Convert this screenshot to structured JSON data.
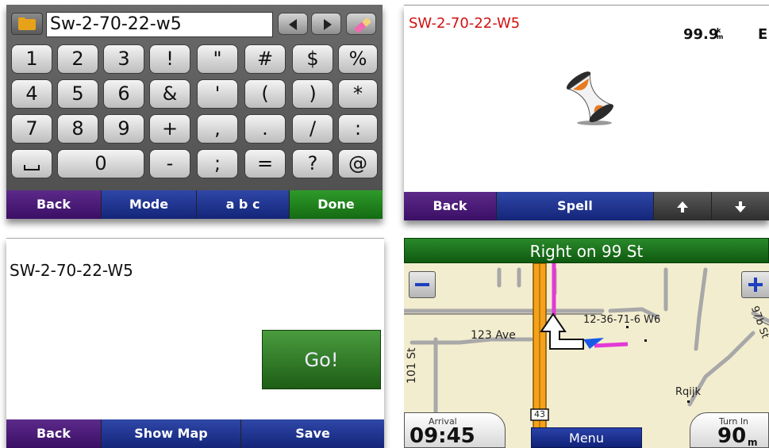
{
  "keyboard_screen": {
    "input_value": "Sw-2-70-22-w5",
    "keys": [
      [
        "1",
        "2",
        "3",
        "!",
        "\"",
        "#",
        "$",
        "%"
      ],
      [
        "4",
        "5",
        "6",
        "&",
        "'",
        "(",
        ")",
        "*"
      ],
      [
        "7",
        "8",
        "9",
        "+",
        ",",
        ".",
        "/",
        ":"
      ],
      [
        "",
        "0",
        "-",
        ";",
        "=",
        "?",
        "@"
      ]
    ],
    "buttons": {
      "back": "Back",
      "mode": "Mode",
      "abc": "a b c",
      "done": "Done"
    }
  },
  "search_screen": {
    "title": "SW-2-70-22-W5",
    "progress_text": "99.9",
    "progress_unit": "k\nm",
    "direction": "E",
    "buttons": {
      "back": "Back",
      "spell": "Spell"
    }
  },
  "address_screen": {
    "title": "SW-2-70-22-W5",
    "go_label": "Go!",
    "buttons": {
      "back": "Back",
      "show_map": "Show Map",
      "save": "Save"
    }
  },
  "map_screen": {
    "next_turn": "Right on 99 St",
    "labels": {
      "ave_123": "123 Ave",
      "st_101": "101 St",
      "destination": "12-36-71-6 W6",
      "poi": "Rqijk",
      "st_97b": "97b St",
      "highway": "43"
    },
    "arrival_label": "Arrival",
    "arrival_value": "09:45",
    "turn_label": "Turn In",
    "turn_value": "90",
    "turn_unit": "m",
    "menu_label": "Menu"
  },
  "colors": {
    "accent_red": "#d21010",
    "green_button": "#2e9a2a",
    "blue_button": "#142579",
    "purple_button": "#3b0f66",
    "route_orange": "#f5a21a",
    "route_magenta": "#e23ad6"
  }
}
